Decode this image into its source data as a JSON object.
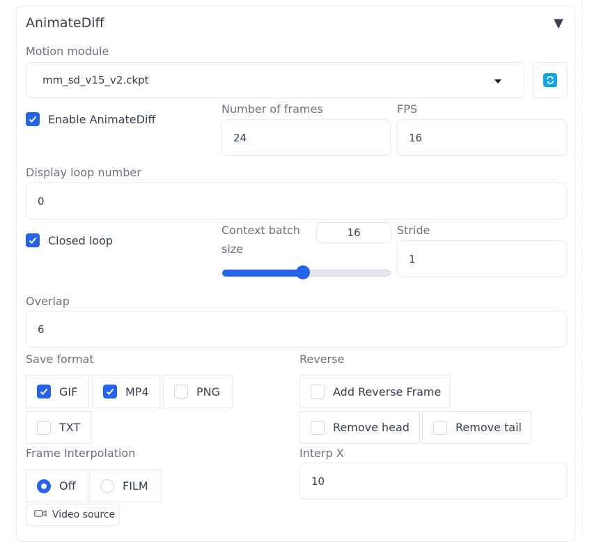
{
  "panel": {
    "title": "AnimateDiff"
  },
  "motion_module": {
    "label": "Motion module",
    "value": "mm_sd_v15_v2.ckpt"
  },
  "enable": {
    "label": "Enable AnimateDiff",
    "checked": true
  },
  "frames": {
    "label": "Number of frames",
    "value": "24"
  },
  "fps": {
    "label": "FPS",
    "value": "16"
  },
  "loop": {
    "label": "Display loop number",
    "value": "0"
  },
  "closed_loop": {
    "label": "Closed loop",
    "checked": true
  },
  "context_batch": {
    "label_line1": "Context batch",
    "label_line2": "size",
    "value": "16",
    "slider_fraction": 0.48
  },
  "stride": {
    "label": "Stride",
    "value": "1"
  },
  "overlap": {
    "label": "Overlap",
    "value": "6"
  },
  "save_format": {
    "label": "Save format",
    "options": [
      {
        "label": "GIF",
        "checked": true
      },
      {
        "label": "MP4",
        "checked": true
      },
      {
        "label": "PNG",
        "checked": false
      },
      {
        "label": "TXT",
        "checked": false
      }
    ]
  },
  "reverse": {
    "label": "Reverse",
    "options": [
      {
        "label": "Add Reverse Frame",
        "checked": false
      },
      {
        "label": "Remove head",
        "checked": false
      },
      {
        "label": "Remove tail",
        "checked": false
      }
    ]
  },
  "interp": {
    "label": "Frame Interpolation",
    "options": [
      {
        "label": "Off",
        "selected": true
      },
      {
        "label": "FILM",
        "selected": false
      }
    ]
  },
  "interp_x": {
    "label": "Interp X",
    "value": "10"
  },
  "video_source": {
    "label": "Video source"
  },
  "colors": {
    "accent": "#2563eb",
    "refresh": "#0ea5e9",
    "border": "#e5e7eb"
  },
  "icons": {
    "collapse": "triangle-down-icon",
    "refresh": "refresh-icon",
    "dropdown": "chevron-down-icon",
    "video": "video-camera-icon",
    "check": "check-icon"
  }
}
